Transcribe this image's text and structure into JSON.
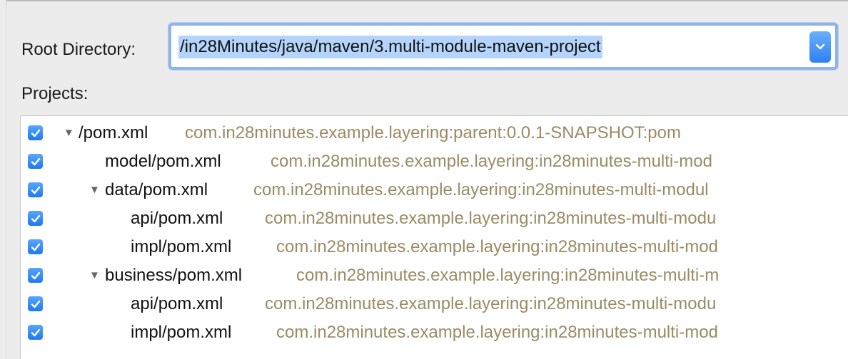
{
  "root": {
    "label": "Root Directory:",
    "value": "/in28Minutes/java/maven/3.multi-module-maven-project"
  },
  "projects": {
    "label": "Projects:",
    "items": [
      {
        "expander": "▼",
        "path": "/pom.xml",
        "coordinates": "com.in28minutes.example.layering:parent:0.0.1-SNAPSHOT:pom",
        "checked": true
      },
      {
        "expander": "",
        "path": "model/pom.xml",
        "coordinates": "com.in28minutes.example.layering:in28minutes-multi-mod",
        "checked": true
      },
      {
        "expander": "▼",
        "path": "data/pom.xml",
        "coordinates": "com.in28minutes.example.layering:in28minutes-multi-modul",
        "checked": true
      },
      {
        "expander": "",
        "path": "api/pom.xml",
        "coordinates": "com.in28minutes.example.layering:in28minutes-multi-modu",
        "checked": true
      },
      {
        "expander": "",
        "path": "impl/pom.xml",
        "coordinates": "com.in28minutes.example.layering:in28minutes-multi-mod",
        "checked": true
      },
      {
        "expander": "▼",
        "path": "business/pom.xml",
        "coordinates": "com.in28minutes.example.layering:in28minutes-multi-m",
        "checked": true
      },
      {
        "expander": "",
        "path": "api/pom.xml",
        "coordinates": "com.in28minutes.example.layering:in28minutes-multi-modu",
        "checked": true
      },
      {
        "expander": "",
        "path": "impl/pom.xml",
        "coordinates": "com.in28minutes.example.layering:in28minutes-multi-mod",
        "checked": true
      }
    ]
  },
  "colors": {
    "accent": "#2f80f3",
    "selection": "#b4d4fb",
    "coordinates_text": "#9b8a63"
  },
  "icons": {
    "checkbox": "checkmark-icon",
    "expander": "disclosure-triangle-icon",
    "dropdown": "chevron-down-icon"
  }
}
